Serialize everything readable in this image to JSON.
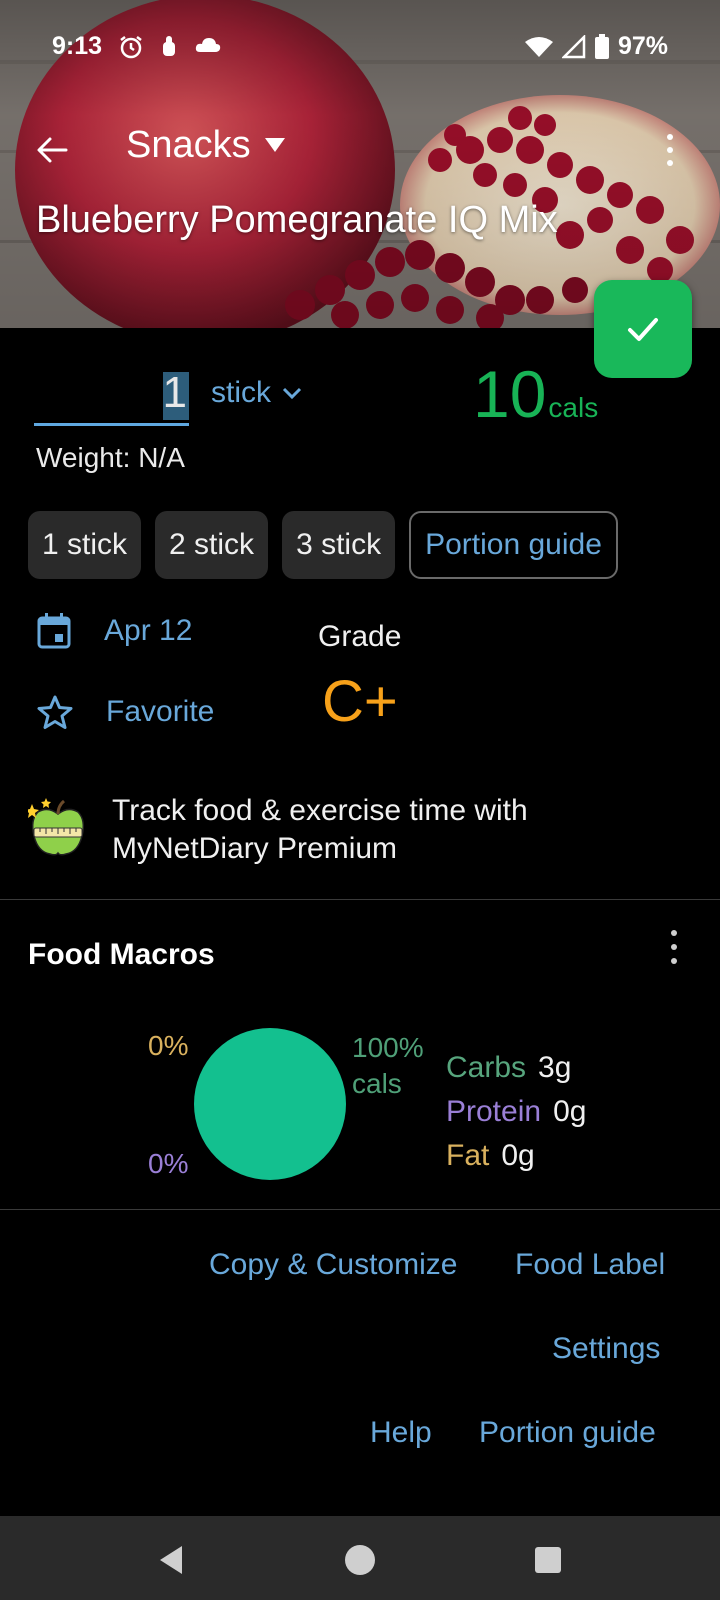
{
  "status_bar": {
    "time": "9:13",
    "battery": "97%"
  },
  "app_bar": {
    "meal": "Snacks"
  },
  "food": {
    "name": "Blueberry Pomegranate IQ Mix"
  },
  "entry": {
    "quantity": "1",
    "unit": "stick",
    "calories": "10",
    "calories_unit": "cals",
    "weight": "Weight: N/A"
  },
  "portions": [
    "1 stick",
    "2 stick",
    "3 stick"
  ],
  "portion_guide_label": "Portion guide",
  "date": "Apr 12",
  "favorite_label": "Favorite",
  "grade": {
    "label": "Grade",
    "value": "C+"
  },
  "promo": {
    "line1": "Track food & exercise time with",
    "line2": "MyNetDiary Premium"
  },
  "macros": {
    "title": "Food Macros",
    "fat_pct": "0%",
    "protein_pct": "0%",
    "carbs_pct_line1": "100%",
    "carbs_pct_line2": "cals",
    "carbs_label": "Carbs",
    "carbs_value": "3g",
    "protein_label": "Protein",
    "protein_value": "0g",
    "fat_label": "Fat",
    "fat_value": "0g",
    "colors": {
      "carbs": "#13c08f",
      "protein": "#9a7fd6",
      "fat": "#d9b15e"
    },
    "carbs_share": 1.0
  },
  "links": {
    "copy": "Copy & Customize",
    "food_label": "Food Label",
    "settings": "Settings",
    "help": "Help",
    "portion_guide": "Portion guide"
  },
  "colors": {
    "accent_blue": "#69a8da",
    "calories_green": "#18b356",
    "fab_green": "#19b85a",
    "grade_orange": "#f7a11a"
  }
}
